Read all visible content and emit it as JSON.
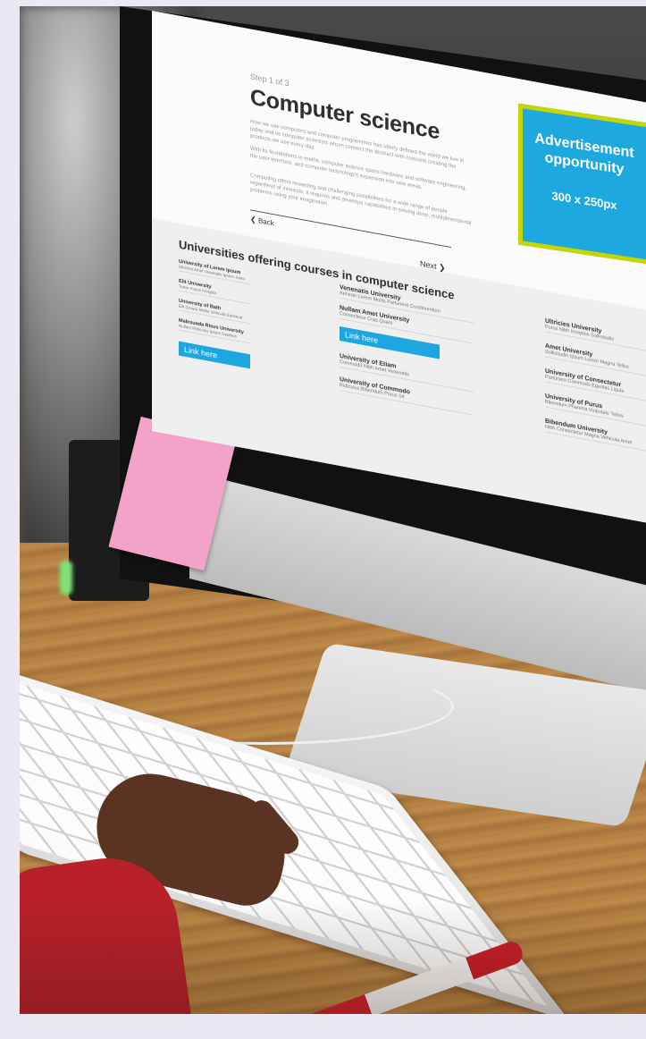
{
  "page": {
    "step": "Step 1 of 3",
    "title": "Computer science",
    "paragraphs": [
      "How we use computers and computer programmes has utterly defined the world we live in today and its computer scientists whom connect the abstract with concrete creating the products we use every day.",
      "With its foundations in maths, computer science spans hardware and software engineering, the user interface, and computer technology's expansion into new areas.",
      "Computing offers rewarding and challenging possibilities for a wide range of people regardless of interests. It requires and develops capabilities in solving deep, multidimensional problems using your imagination."
    ],
    "back_label": "Back",
    "next_label": "Next"
  },
  "ad": {
    "line1": "Advertisement",
    "line2": "opportunity",
    "size": "300 x 250px",
    "border_color": "#c6d600",
    "fill_color": "#1ea8e0"
  },
  "universities": {
    "title": "Universities offering courses in computer science",
    "link_label_1": "Link here",
    "link_label_2": "Link here",
    "col1": [
      {
        "name": "University of Lorem Ipsum",
        "desc": "Ultricies Amet Venenatis Ipsum Justo"
      },
      {
        "name": "Elit University",
        "desc": "Tortor Fusce Fringilla"
      },
      {
        "name": "University of Bath",
        "desc": "Elit Ornare Mollis Vehicula Euismod"
      },
      {
        "name": "Malesuada Risus University",
        "desc": "Nullam Ridiculus Ipsum Dapibus"
      }
    ],
    "col2": [
      {
        "name": "Venenatis University",
        "desc": "Aenean Lorem Mollis Parturient Condimentum"
      },
      {
        "name": "Nullam Amet University",
        "desc": "Consectetur Cras Quam"
      },
      {
        "name": "University of Etiam",
        "desc": "Commodo Nibh Amet Venenatis"
      },
      {
        "name": "University of Commodo",
        "desc": "Ridiculus Bibendum Purus Sit"
      }
    ],
    "col3": [
      {
        "name": "Ultricies University",
        "desc": "Purus Nibh Inceptos Sollicitudin"
      },
      {
        "name": "Amet University",
        "desc": "Sollicitudin Ipsum Lorem Magna Tellus"
      },
      {
        "name": "University of Consectetur",
        "desc": "Parturient Commodo Egestas Ligula"
      },
      {
        "name": "University of Purus",
        "desc": "Bibendum Pharetra Vulputate Tellus"
      },
      {
        "name": "Bibendum University",
        "desc": "Nibh Consectetur Magna Vehicula Amet"
      }
    ],
    "accent": "#1ea6e0"
  }
}
